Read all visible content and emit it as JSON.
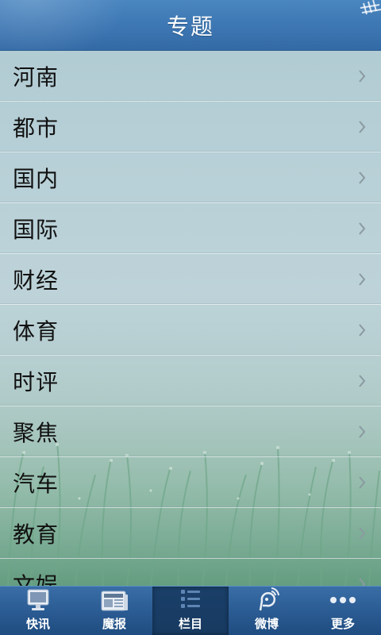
{
  "header": {
    "title": "专题"
  },
  "list": {
    "items": [
      {
        "label": "河南"
      },
      {
        "label": "都市"
      },
      {
        "label": "国内"
      },
      {
        "label": "国际"
      },
      {
        "label": "财经"
      },
      {
        "label": "体育"
      },
      {
        "label": "时评"
      },
      {
        "label": "聚焦"
      },
      {
        "label": "汽车"
      },
      {
        "label": "教育"
      },
      {
        "label": "文娱"
      }
    ]
  },
  "tabbar": {
    "tabs": [
      {
        "label": "快讯",
        "icon": "monitor-icon"
      },
      {
        "label": "魔报",
        "icon": "newspaper-icon"
      },
      {
        "label": "栏目",
        "icon": "list-icon",
        "active": true
      },
      {
        "label": "微博",
        "icon": "weibo-icon"
      },
      {
        "label": "更多",
        "icon": "more-dots-icon"
      }
    ]
  },
  "colors": {
    "header": "#3f79b5",
    "tabbar": "#2b5c93",
    "tab_active": "#173a61",
    "list_background": "#b8cfd6"
  }
}
